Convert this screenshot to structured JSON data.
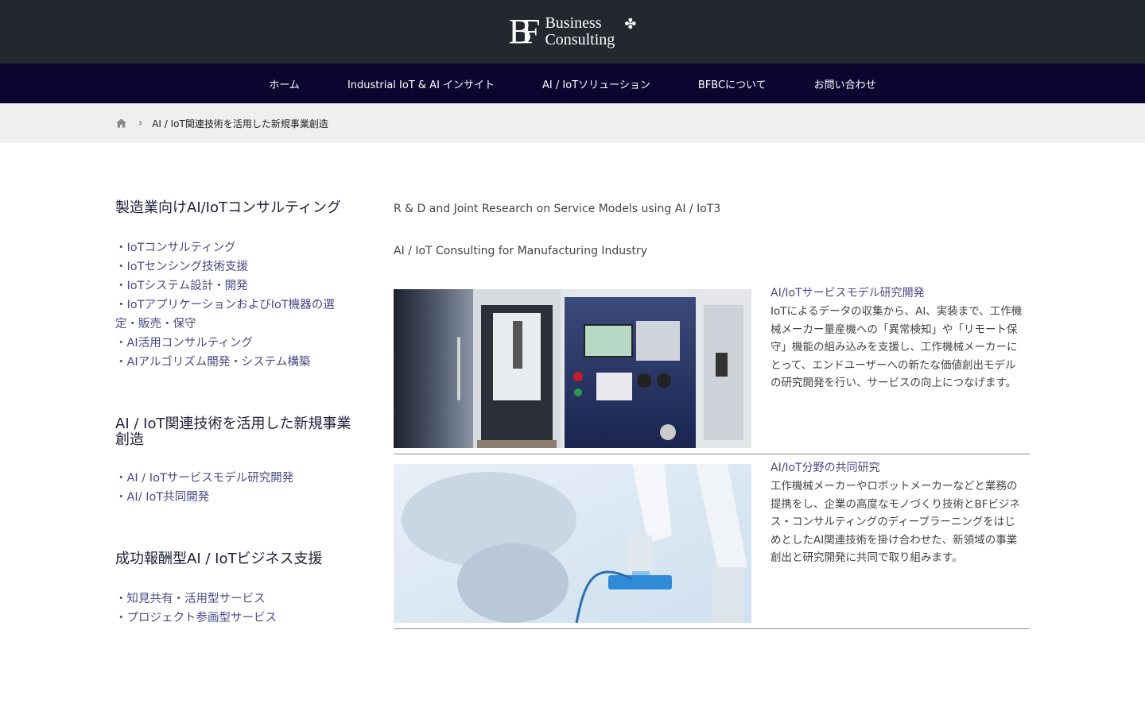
{
  "logo": {
    "mark": "BF",
    "line1": "Business",
    "line2": "Consulting",
    "clover": "✤"
  },
  "nav": {
    "items": [
      {
        "label": "ホーム"
      },
      {
        "label": "Industrial IoT & AI インサイト"
      },
      {
        "label": "AI / IoTソリューション"
      },
      {
        "label": "BFBCについて"
      },
      {
        "label": "お問い合わせ"
      }
    ]
  },
  "breadcrumb": {
    "separator": "›",
    "current": "AI / IoT関連技術を活用した新規事業創造"
  },
  "sidebar": {
    "sections": [
      {
        "heading": "製造業向けAI/IoTコンサルティング",
        "items": [
          "・IoTコンサルティング",
          "・IoTセンシング技術支援",
          "・IoTシステム設計・開発",
          "・IoTアプリケーションおよびIoT機器の選定・販売・保守",
          "・AI活用コンサルティング",
          "・AIアルゴリズム開発・システム構築"
        ]
      },
      {
        "heading": "AI / IoT関連技術を活用した新規事業創造",
        "items": [
          "・AI / IoTサービスモデル研究開発",
          "・AI/ IoT共同開発"
        ]
      },
      {
        "heading": "成功報酬型AI / IoTビジネス支援",
        "items": [
          "・知見共有・活用型サービス",
          "・プロジェクト参画型サービス"
        ]
      }
    ]
  },
  "main": {
    "line1": "R & D and Joint Research on Service Models using AI / IoT3",
    "line2": "AI / IoT Consulting for Manufacturing Industry",
    "features": [
      {
        "title": "AI/IoTサービスモデル研究開発",
        "body": "IoTによるデータの収集から、AI、実装まで、工作機械メーカー量産機への「異常検知」や「リモート保守」機能の組み込みを支援し、工作機械メーカーにとって、エンドユーザーへの新たな価値創出モデルの研究開発を行い、サービスの向上につなげます。"
      },
      {
        "title": "AI/IoT分野の共同研究",
        "body": "工作機械メーカーやロボットメーカーなどと業務の提携をし、企業の高度なモノづくり技術とBFビジネス・コンサルティングのディープラーニングをはじめとしたAI関連技術を掛け合わせた、新領域の事業創出と研究開発に共同で取り組みます。"
      }
    ]
  }
}
